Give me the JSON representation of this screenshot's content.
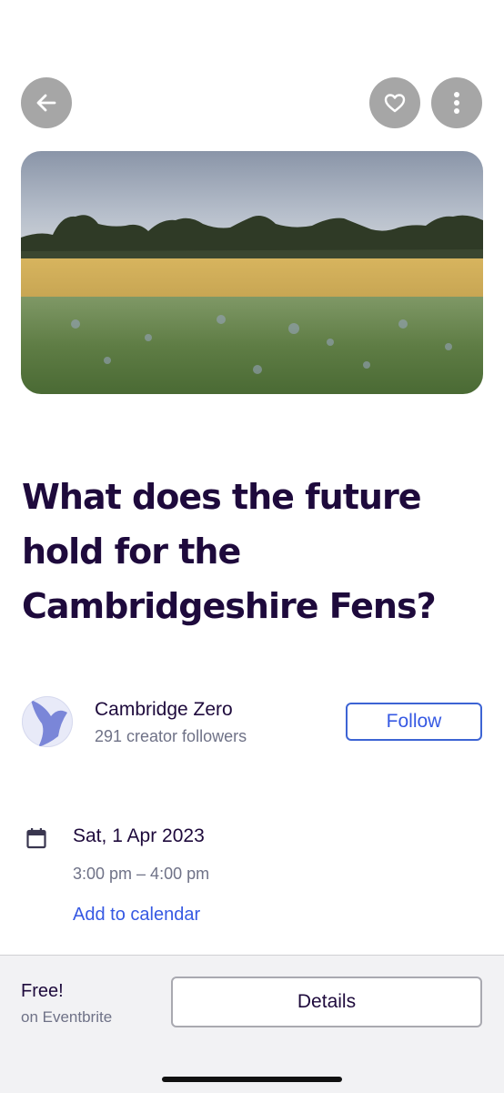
{
  "header": {
    "back_icon": "arrow-left-icon",
    "favorite_icon": "heart-icon",
    "more_icon": "more-vertical-icon"
  },
  "event": {
    "title": "What does the future hold for the Cambridgeshire Fens?",
    "image_description": "field-landscape"
  },
  "organizer": {
    "name": "Cambridge Zero",
    "followers": "291 creator followers",
    "follow_label": "Follow"
  },
  "schedule": {
    "date": "Sat, 1 Apr 2023",
    "time": "3:00 pm – 4:00 pm",
    "add_to_calendar": "Add to calendar"
  },
  "footer": {
    "price": "Free!",
    "price_sub": "on Eventbrite",
    "details_label": "Details"
  },
  "colors": {
    "accent": "#3659e3",
    "title": "#1e0a3c",
    "muted": "#6f7287"
  }
}
